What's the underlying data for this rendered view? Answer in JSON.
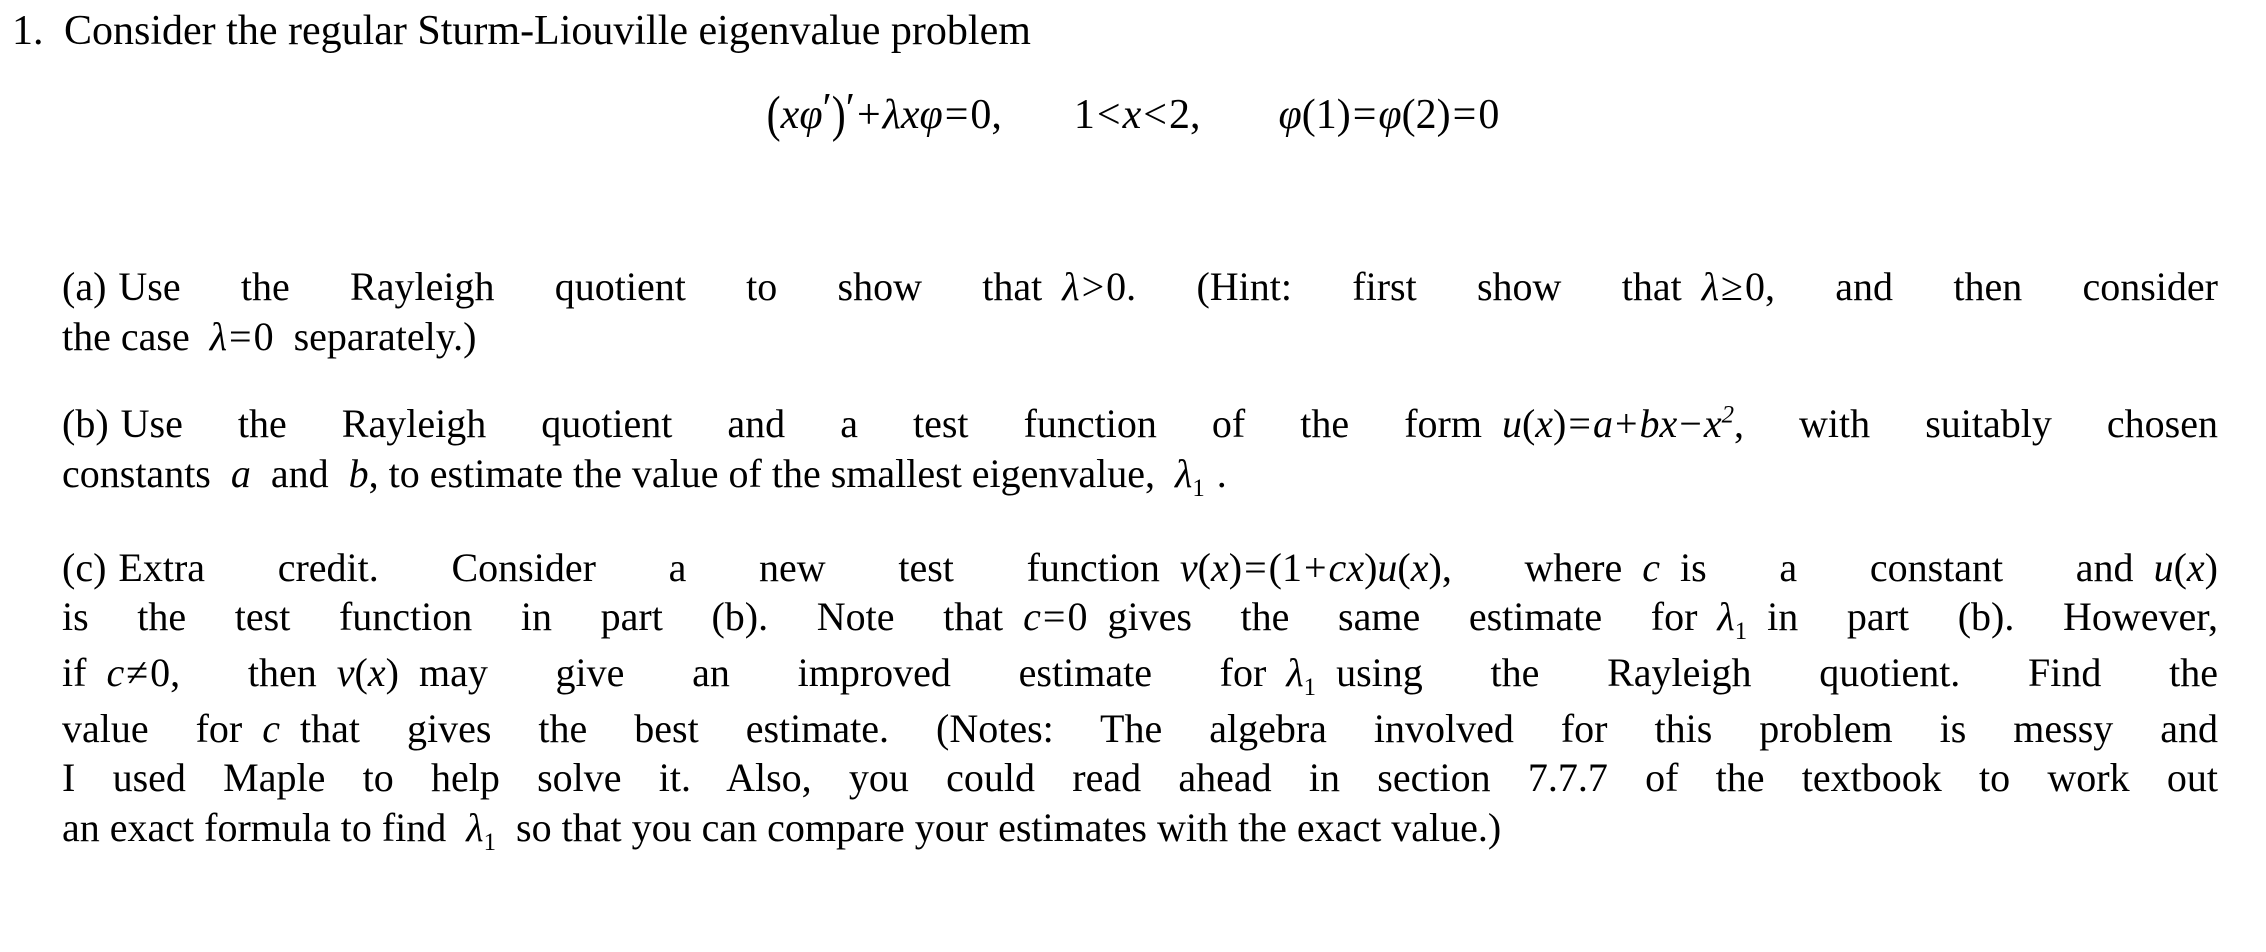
{
  "document": {
    "type": "math-homework-problem",
    "background_color": "#ffffff",
    "text_color": "#000000"
  },
  "problem": {
    "number": "1.",
    "stem": "Consider the regular Sturm-Liouville eigenvalue problem",
    "equation": {
      "plain": "(xφ′)′ + λxφ = 0,    1 < x < 2,    φ(1) = φ(2) = 0",
      "ode_lhs": "(xφ′)′ + λxφ",
      "ode_rhs": "0",
      "domain": "1 < x < 2",
      "boundary_conditions": "φ(1) = φ(2) = 0"
    }
  },
  "parts": [
    {
      "label": "(a)",
      "lines": [
        "(a) Use the Rayleigh quotient to show that  λ > 0 .  (Hint:  first show that  λ ≥ 0 , and then consider",
        "the case  λ = 0  separately.)"
      ],
      "text": "(a) Use the Rayleigh quotient to show that λ > 0. (Hint: first show that λ ≥ 0, and then consider the case λ = 0 separately.)"
    },
    {
      "label": "(b)",
      "lines": [
        "(b) Use the Rayleigh quotient and a test function of the form  u(x) = a + bx − x² , with suitably chosen",
        "constants  a  and  b , to estimate the value of the smallest eigenvalue,  λ₁ ."
      ],
      "text": "(b) Use the Rayleigh quotient and a test function of the form u(x) = a + bx − x², with suitably chosen constants a and b, to estimate the value of the smallest eigenvalue, λ₁."
    },
    {
      "label": "(c)",
      "lines": [
        "(c) Extra credit.  Consider a new test function  v(x) = (1 + cx)u(x) , where  c  is a constant and  u(x)",
        "is the test function in part (b).  Note that  c = 0  gives the same estimate for  λ₁  in part (b).  However,",
        "if  c ≠ 0 , then  v(x)  may give an improved estimate for  λ₁  using the Rayleigh quotient.  Find the",
        "value for  c  that gives the best estimate.  (Notes: The algebra involved for this problem is messy and",
        "I used Maple to help solve it.  Also, you could read ahead in section 7.7.7 of the textbook to work out",
        "an exact formula to find  λ₁  so that you can compare your estimates with the exact value.)"
      ],
      "text": "(c) Extra credit. Consider a new test function v(x) = (1 + cx)u(x), where c is a constant and u(x) is the test function in part (b). Note that c = 0 gives the same estimate for λ₁ in part (b). However, if c ≠ 0, then v(x) may give an improved estimate for λ₁ using the Rayleigh quotient. Find the value for c that gives the best estimate. (Notes: The algebra involved for this problem is messy and I used Maple to help solve it. Also, you could read ahead in section 7.7.7 of the textbook to work out an exact formula to find λ₁ so that you can compare your estimates with the exact value.)"
    }
  ],
  "fragments": {
    "a_l1_p1": "Use the Rayleigh quotient to show that",
    "a_l1_ineq": "λ > 0",
    "a_l1_p2": ". (Hint: first show that",
    "a_l1_ineq2": "λ ≥ 0",
    "a_l1_p3": ", and then consider",
    "a_l2_p1": "the case",
    "a_l2_eq": "λ = 0",
    "a_l2_p2": "separately.)",
    "b_l1_p1": "Use the Rayleigh quotient and a test function of the form",
    "b_l1_p2": ", with suitably chosen",
    "b_l2_p1": "constants",
    "b_l2_var_a": "a",
    "b_l2_and": "and",
    "b_l2_var_b": "b",
    "b_l2_p2": ", to estimate the value of the smallest eigenvalue,",
    "b_l2_end": ".",
    "c_l1_p1": "Extra credit. Consider a new test function",
    "c_l1_p2": ", where",
    "c_l1_var_c": "c",
    "c_l1_p3": "is a constant and",
    "c_l2_p1": "is the test function in part (b). Note that",
    "c_l2_eq": "c = 0",
    "c_l2_p2": "gives the same estimate for",
    "c_l2_p3": "in part (b). However,",
    "c_l3_p1": "if",
    "c_l3_neq": "c ≠ 0",
    "c_l3_p2": ", then",
    "c_l3_p3": "may give an improved estimate for",
    "c_l3_p4": "using the Rayleigh quotient. Find the",
    "c_l4_p1": "value for",
    "c_l4_var_c": "c",
    "c_l4_p2": "that gives the best estimate. (Notes: The algebra involved for this problem is messy and",
    "c_l5": "I used Maple to help solve it. Also, you could read ahead in section 7.7.7 of the textbook to work out",
    "c_l6_p1": "an exact formula to find",
    "c_l6_p2": "so that you can compare your estimates with the exact value.)"
  },
  "symbols": {
    "lambda": "λ",
    "phi": "φ",
    "x": "x",
    "u": "u",
    "v": "v",
    "a": "a",
    "b": "b",
    "c": "c",
    "one": "1",
    "two": "2",
    "zero": "0",
    "plus": "+",
    "minus": "−",
    "equals": "=",
    "less_than": "<",
    "greater_than": ">",
    "geq": "≥",
    "neq": "≠",
    "prime": "′",
    "lparen": "(",
    "rparen": ")",
    "comma": ",",
    "period": ".",
    "sub_one": "1",
    "sup_two": "2"
  }
}
